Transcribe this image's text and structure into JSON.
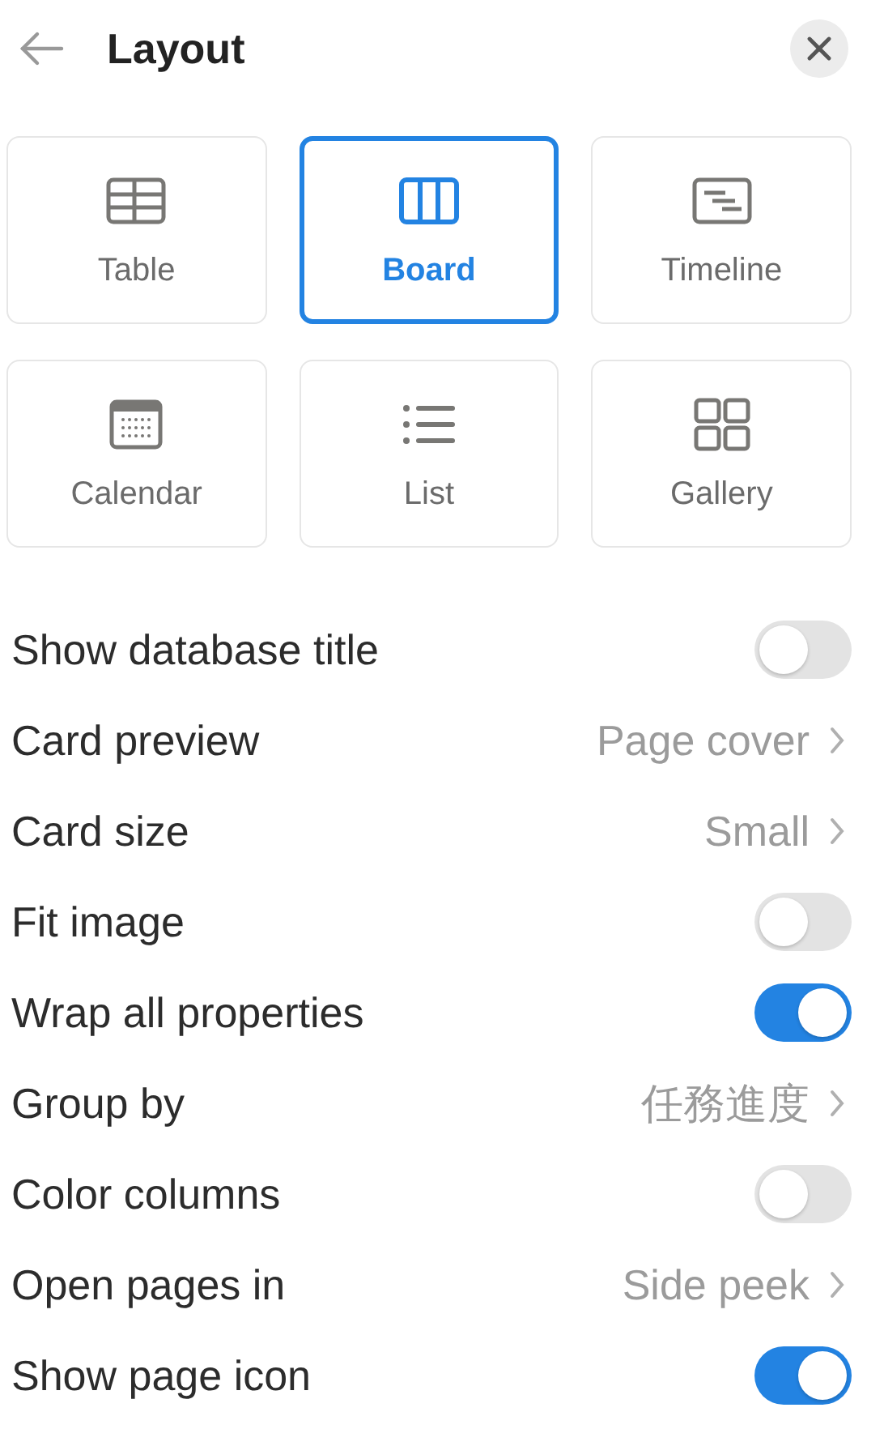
{
  "header": {
    "title": "Layout"
  },
  "layouts": [
    {
      "kind": "table",
      "label": "Table",
      "selected": false
    },
    {
      "kind": "board",
      "label": "Board",
      "selected": true
    },
    {
      "kind": "timeline",
      "label": "Timeline",
      "selected": false
    },
    {
      "kind": "calendar",
      "label": "Calendar",
      "selected": false
    },
    {
      "kind": "list",
      "label": "List",
      "selected": false
    },
    {
      "kind": "gallery",
      "label": "Gallery",
      "selected": false
    }
  ],
  "settings": [
    {
      "kind": "toggle",
      "label": "Show database title",
      "on": false
    },
    {
      "kind": "select",
      "label": "Card preview",
      "value": "Page cover"
    },
    {
      "kind": "select",
      "label": "Card size",
      "value": "Small"
    },
    {
      "kind": "toggle",
      "label": "Fit image",
      "on": false
    },
    {
      "kind": "toggle",
      "label": "Wrap all properties",
      "on": true
    },
    {
      "kind": "select",
      "label": "Group by",
      "value": "任務進度"
    },
    {
      "kind": "toggle",
      "label": "Color columns",
      "on": false
    },
    {
      "kind": "select",
      "label": "Open pages in",
      "value": "Side peek"
    },
    {
      "kind": "toggle",
      "label": "Show page icon",
      "on": true
    }
  ]
}
